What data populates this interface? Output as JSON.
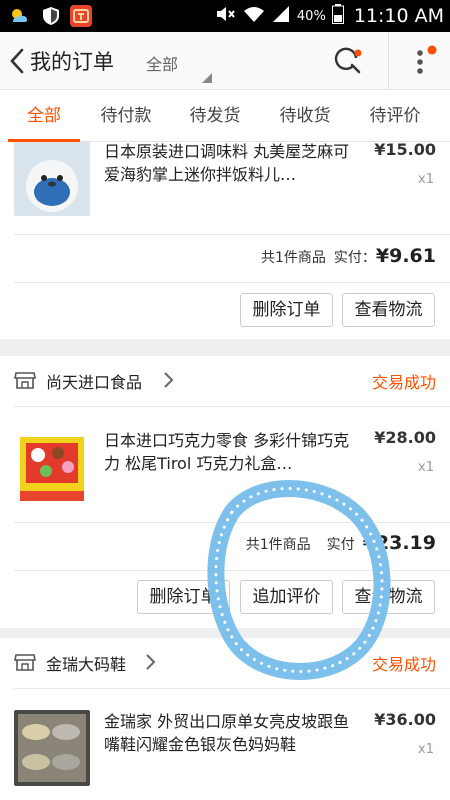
{
  "status_bar": {
    "battery_percent": "40%",
    "clock": "11:10 AM",
    "icons": [
      "weather-icon",
      "shield-icon",
      "taobao-app-icon",
      "mute-icon",
      "wifi-icon",
      "signal-icon",
      "battery-icon"
    ]
  },
  "header": {
    "title": "我的订单",
    "filter_label": "全部",
    "icons": [
      "back-arrow-icon",
      "search-icon",
      "more-icon"
    ]
  },
  "tabs": [
    {
      "label": "全部",
      "active": true
    },
    {
      "label": "待付款",
      "active": false
    },
    {
      "label": "待发货",
      "active": false
    },
    {
      "label": "待收货",
      "active": false
    },
    {
      "label": "待评价",
      "active": false
    }
  ],
  "orders": [
    {
      "item_title": "日本原装进口调味料 丸美屋芝麻可爱海豹掌上迷你拌饭料儿…",
      "item_price": "¥15.00",
      "item_qty": "x1",
      "summary_count": "共1件商品",
      "summary_paid_label": "实付：",
      "summary_total": "¥9.61",
      "buttons": [
        "删除订单",
        "查看物流"
      ]
    },
    {
      "store_name": "尚天进口食品",
      "status": "交易成功",
      "item_title": "日本进口巧克力零食 多彩什锦巧克力 松尾Tirol 巧克力礼盒…",
      "item_price": "¥28.00",
      "item_qty": "x1",
      "summary_count": "共1件商品",
      "summary_paid_label": "实付",
      "summary_total": "¥23.19",
      "buttons": [
        "删除订单",
        "追加评价",
        "查看物流"
      ]
    },
    {
      "store_name": "金瑞大码鞋",
      "status": "交易成功",
      "item_title": "金瑞家 外贸出口原单女亮皮坡跟鱼嘴鞋闪耀金色银灰色妈妈鞋",
      "item_price": "¥36.00",
      "item_qty": "x1"
    }
  ],
  "colors": {
    "accent": "#ff5000",
    "annotation_ring": "#7ec0ec"
  }
}
